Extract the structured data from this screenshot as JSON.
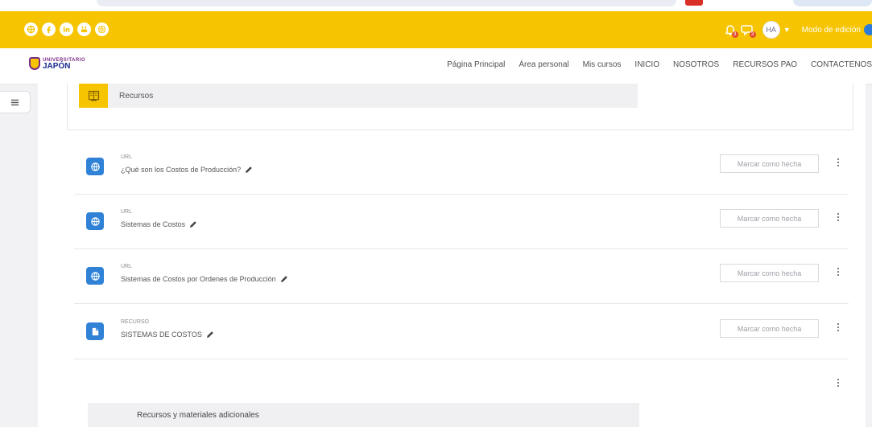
{
  "header": {
    "social_icons": [
      "globe-icon",
      "facebook-icon",
      "linkedin-icon",
      "youtube-icon",
      "instagram-icon"
    ],
    "notifications_count": "3",
    "messages_count": "3",
    "user_initials": "HA",
    "edit_mode_label": "Modo de edición",
    "accent_color": "#f6c400"
  },
  "brand": {
    "line1": "UNIVERSITARIO",
    "line2": "JAPÓN"
  },
  "nav": {
    "items": [
      "Página Principal",
      "Área personal",
      "Mis cursos",
      "INICIO",
      "NOSOTROS",
      "RECURSOS PAO",
      "CONTACTENOS"
    ]
  },
  "section": {
    "title": "Recursos"
  },
  "activities": [
    {
      "type": "URL",
      "name": "¿Qué son los Costos de Producción?",
      "icon": "globe-icon",
      "button": "Marcar como hecha"
    },
    {
      "type": "URL",
      "name": "Sistemas de Costos",
      "icon": "globe-icon",
      "button": "Marcar como hecha"
    },
    {
      "type": "URL",
      "name": "Sistemas de Costos por Ordenes de Producción",
      "icon": "globe-icon",
      "button": "Marcar como hecha"
    },
    {
      "type": "RECURSO",
      "name": "SISTEMAS DE COSTOS",
      "icon": "file-icon",
      "button": "Marcar como hecha"
    }
  ],
  "section2": {
    "title": "Recursos y materiales adicionales"
  }
}
